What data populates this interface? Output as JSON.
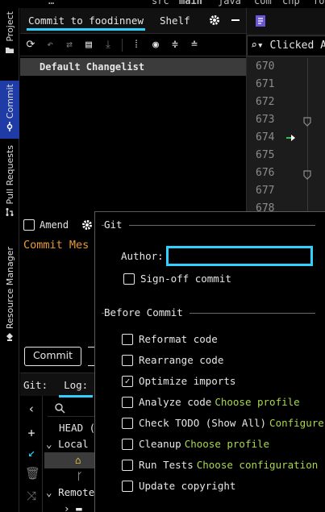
{
  "breadcrumb": {
    "fragments": [
      "…",
      "src",
      "main",
      "java",
      "com",
      "chp",
      "fo"
    ]
  },
  "tool_strip": {
    "project": "Project",
    "commit": "Commit",
    "pull_requests": "Pull Requests",
    "resource_manager": "Resource Manager"
  },
  "commit_panel": {
    "tabs": [
      "Commit to foodinnew",
      "Shelf"
    ],
    "changelist": "Default Changelist",
    "amend_label": "Amend",
    "message_placeholder": "Commit Mes",
    "commit_button": "Commit"
  },
  "git_panel": {
    "label": "Git:",
    "log_tab": "Log: ",
    "tree": [
      "HEAD (",
      "Local",
      "Remote"
    ]
  },
  "editor": {
    "search_text": "Clicked Al",
    "line_numbers": [
      "670",
      "671",
      "672",
      "673",
      "674",
      "675",
      "676",
      "677",
      "678"
    ]
  },
  "popup": {
    "git_section": "Git",
    "author_label": "Author:",
    "author_value": "",
    "signoff_label": "Sign-off commit",
    "before_commit_section": "Before Commit",
    "options": [
      {
        "label": "Reformat code",
        "checked": false,
        "link": ""
      },
      {
        "label": "Rearrange code",
        "checked": false,
        "link": ""
      },
      {
        "label": "Optimize imports",
        "checked": true,
        "link": ""
      },
      {
        "label": "Analyze code",
        "checked": false,
        "link": "Choose profile"
      },
      {
        "label": "Check TODO (Show All)",
        "checked": false,
        "link": "Configure"
      },
      {
        "label": "Cleanup",
        "checked": false,
        "link": "Choose profile"
      },
      {
        "label": "Run Tests",
        "checked": false,
        "link": "Choose configuration"
      },
      {
        "label": "Update copyright",
        "checked": false,
        "link": ""
      }
    ]
  },
  "colors": {
    "accent": "#2fd1ff",
    "link": "#a6d94a",
    "placeholder": "#e89a3c",
    "selection": "#3b3b3b"
  }
}
